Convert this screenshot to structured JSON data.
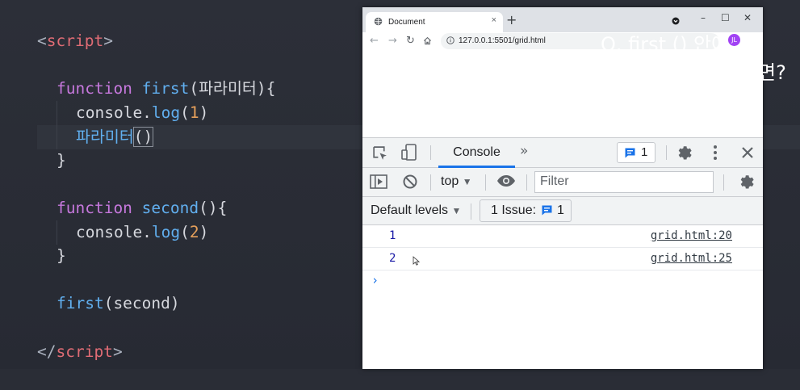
{
  "editor": {
    "lines": {
      "script_open": {
        "lt": "<",
        "tag": "script",
        "gt": ">"
      },
      "first_decl": {
        "kw": "function",
        "name": "first",
        "params": "(파라미터){"
      },
      "first_log": {
        "obj": "console.",
        "method": "log",
        "open": "(",
        "arg": "1",
        "close": ")"
      },
      "first_call": {
        "name": "파라미터",
        "parens": "()"
      },
      "first_close": "}",
      "second_decl": {
        "kw": "function",
        "name": "second",
        "params": "(){"
      },
      "second_log": {
        "obj": "console.",
        "method": "log",
        "open": "(",
        "arg": "2",
        "close": ")"
      },
      "second_close": "}",
      "call": {
        "name": "first",
        "args": "(second)"
      },
      "script_close": {
        "lt": "</",
        "tag": "script",
        "gt": ">"
      }
    }
  },
  "overlay": {
    "line1": "Q. first () 안에",
    "line2": "면?"
  },
  "browser": {
    "tab_title": "Document",
    "tab_close": "×",
    "new_tab": "+",
    "window_controls": {
      "minimize": "–",
      "maximize": "☐",
      "close": "✕"
    },
    "url": "127.0.0.1:5501/grid.html",
    "avatar_label": "JL"
  },
  "devtools": {
    "active_tab": "Console",
    "more_tabs": "»",
    "issues_count": "1",
    "context": "top",
    "filter_placeholder": "Filter",
    "levels": "Default levels",
    "issue_button_label": "1 Issue:",
    "issue_button_count": "1",
    "messages": [
      {
        "value": "1",
        "source": "grid.html:20"
      },
      {
        "value": "2",
        "source": "grid.html:25"
      }
    ],
    "prompt": "›"
  },
  "colors": {
    "editor_bg": "#2a2d36",
    "keyword": "#c678dd",
    "function": "#61afef",
    "number": "#e5a05b",
    "tag": "#e06c75",
    "devtools_accent": "#1a73e8"
  }
}
